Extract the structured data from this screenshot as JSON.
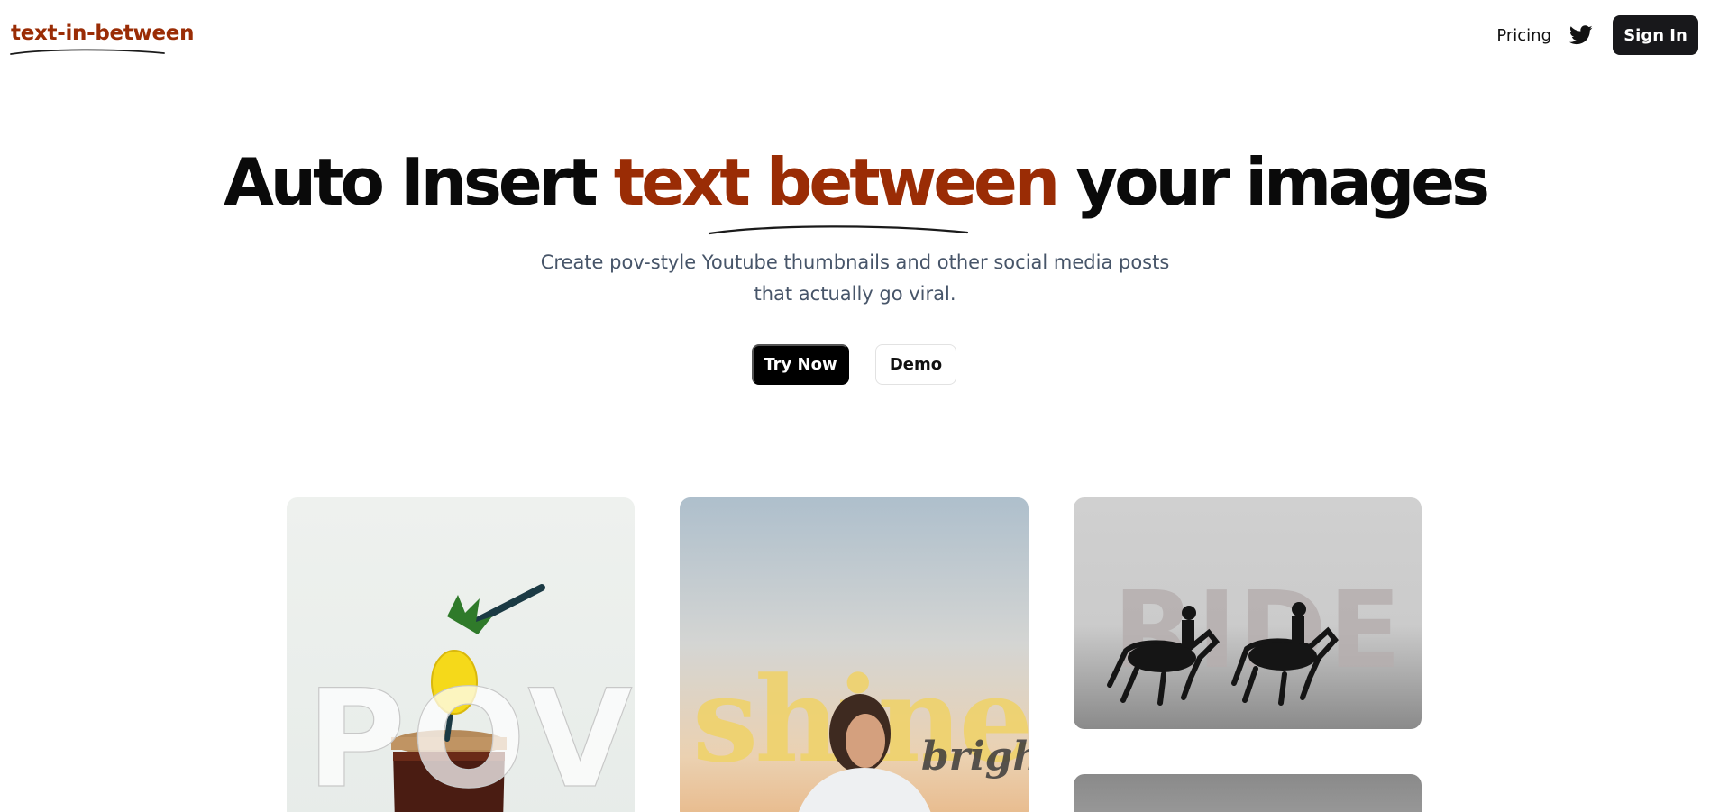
{
  "header": {
    "logo": "text-in-between",
    "nav": {
      "pricing": "Pricing",
      "twitter_icon": "twitter-icon",
      "signin": "Sign In"
    }
  },
  "hero": {
    "headline_before": "Auto Insert ",
    "headline_accent": "text between",
    "headline_after": " your images",
    "subtitle": "Create pov-style Youtube thumbnails and other social media posts that actually go viral.",
    "primary_button": "Try Now",
    "secondary_button": "Demo"
  },
  "gallery": {
    "cards": [
      {
        "overlay_text": "POV"
      },
      {
        "overlay_text": "shine",
        "overlay_sub": "bright"
      },
      {
        "overlay_text": "RIDE"
      },
      {
        "overlay_text": ""
      }
    ]
  },
  "colors": {
    "accent": "#9a2c05",
    "text": "#0a0a0a",
    "muted": "#475569",
    "button_dark": "#18181b"
  }
}
